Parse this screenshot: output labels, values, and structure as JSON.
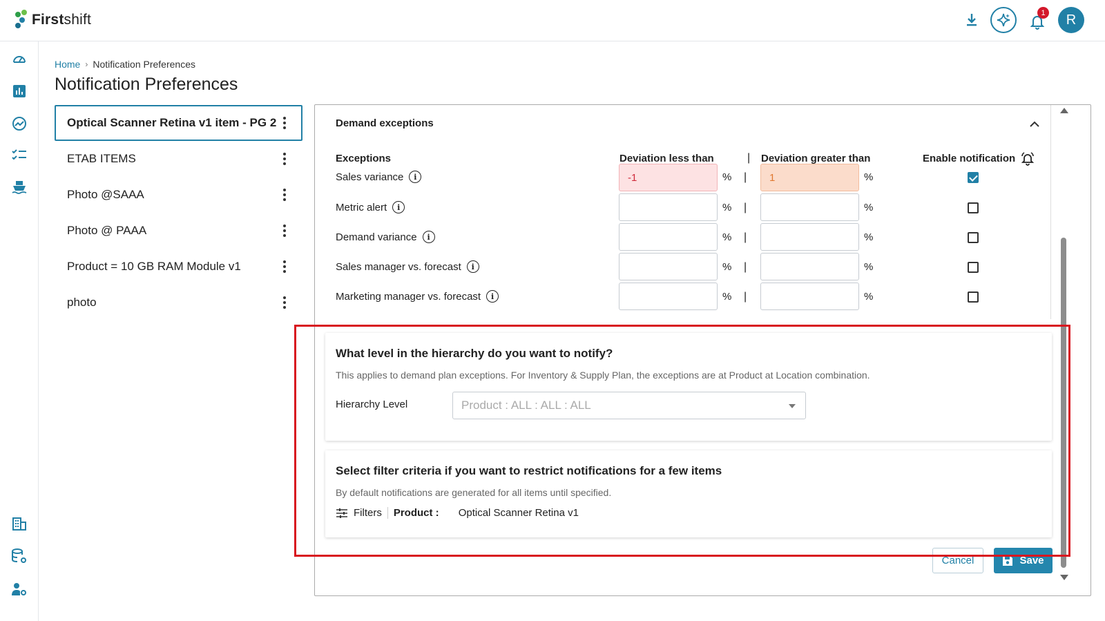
{
  "app": {
    "brand_bold": "First",
    "brand_rest": "shift",
    "notifications_count": "1",
    "avatar_initial": "R",
    "brand_colors": [
      "#2e9e48",
      "#2180a6",
      "#6cc04a",
      "#1a6f8f"
    ]
  },
  "rail_icons": [
    "dashboard-icon",
    "bar-chart-icon",
    "trend-icon",
    "checklist-icon",
    "ship-icon",
    "building-icon",
    "database-settings-icon",
    "user-settings-icon"
  ],
  "breadcrumb": {
    "home": "Home",
    "current": "Notification Preferences"
  },
  "page_title": "Notification Preferences",
  "items": [
    {
      "label": "Optical Scanner Retina v1 item - PG 2",
      "active": true
    },
    {
      "label": "ETAB ITEMS",
      "active": false
    },
    {
      "label": "Photo @SAAA",
      "active": false
    },
    {
      "label": "Photo @ PAAA",
      "active": false
    },
    {
      "label": "Product = 10 GB RAM Module v1",
      "active": false
    },
    {
      "label": "photo",
      "active": false
    }
  ],
  "demand": {
    "title": "Demand exceptions",
    "headers": {
      "exceptions": "Exceptions",
      "less": "Deviation less than",
      "greater": "Deviation greater than",
      "enable": "Enable notification"
    },
    "rows": [
      {
        "label": "Sales variance",
        "less": "-1",
        "greater": "1",
        "enabled": true
      },
      {
        "label": "Metric alert",
        "less": "",
        "greater": "",
        "enabled": false
      },
      {
        "label": "Demand variance",
        "less": "",
        "greater": "",
        "enabled": false
      },
      {
        "label": "Sales manager vs. forecast",
        "less": "",
        "greater": "",
        "enabled": false
      },
      {
        "label": "Marketing manager vs. forecast",
        "less": "",
        "greater": "",
        "enabled": false
      }
    ],
    "pct": "%",
    "pipe": "|"
  },
  "hierarchy": {
    "title": "What level in the hierarchy do you want to notify?",
    "desc": "This applies to demand plan exceptions. For Inventory & Supply Plan, the exceptions are at Product at Location combination.",
    "label": "Hierarchy Level",
    "value": "Product : ALL : ALL : ALL"
  },
  "filter": {
    "title": "Select filter criteria if you want to restrict notifications for a few items",
    "desc": "By default notifications are generated for all items until specified.",
    "filters_label": "Filters",
    "key": "Product :",
    "value": "Optical Scanner Retina v1"
  },
  "buttons": {
    "cancel": "Cancel",
    "save": "Save"
  }
}
